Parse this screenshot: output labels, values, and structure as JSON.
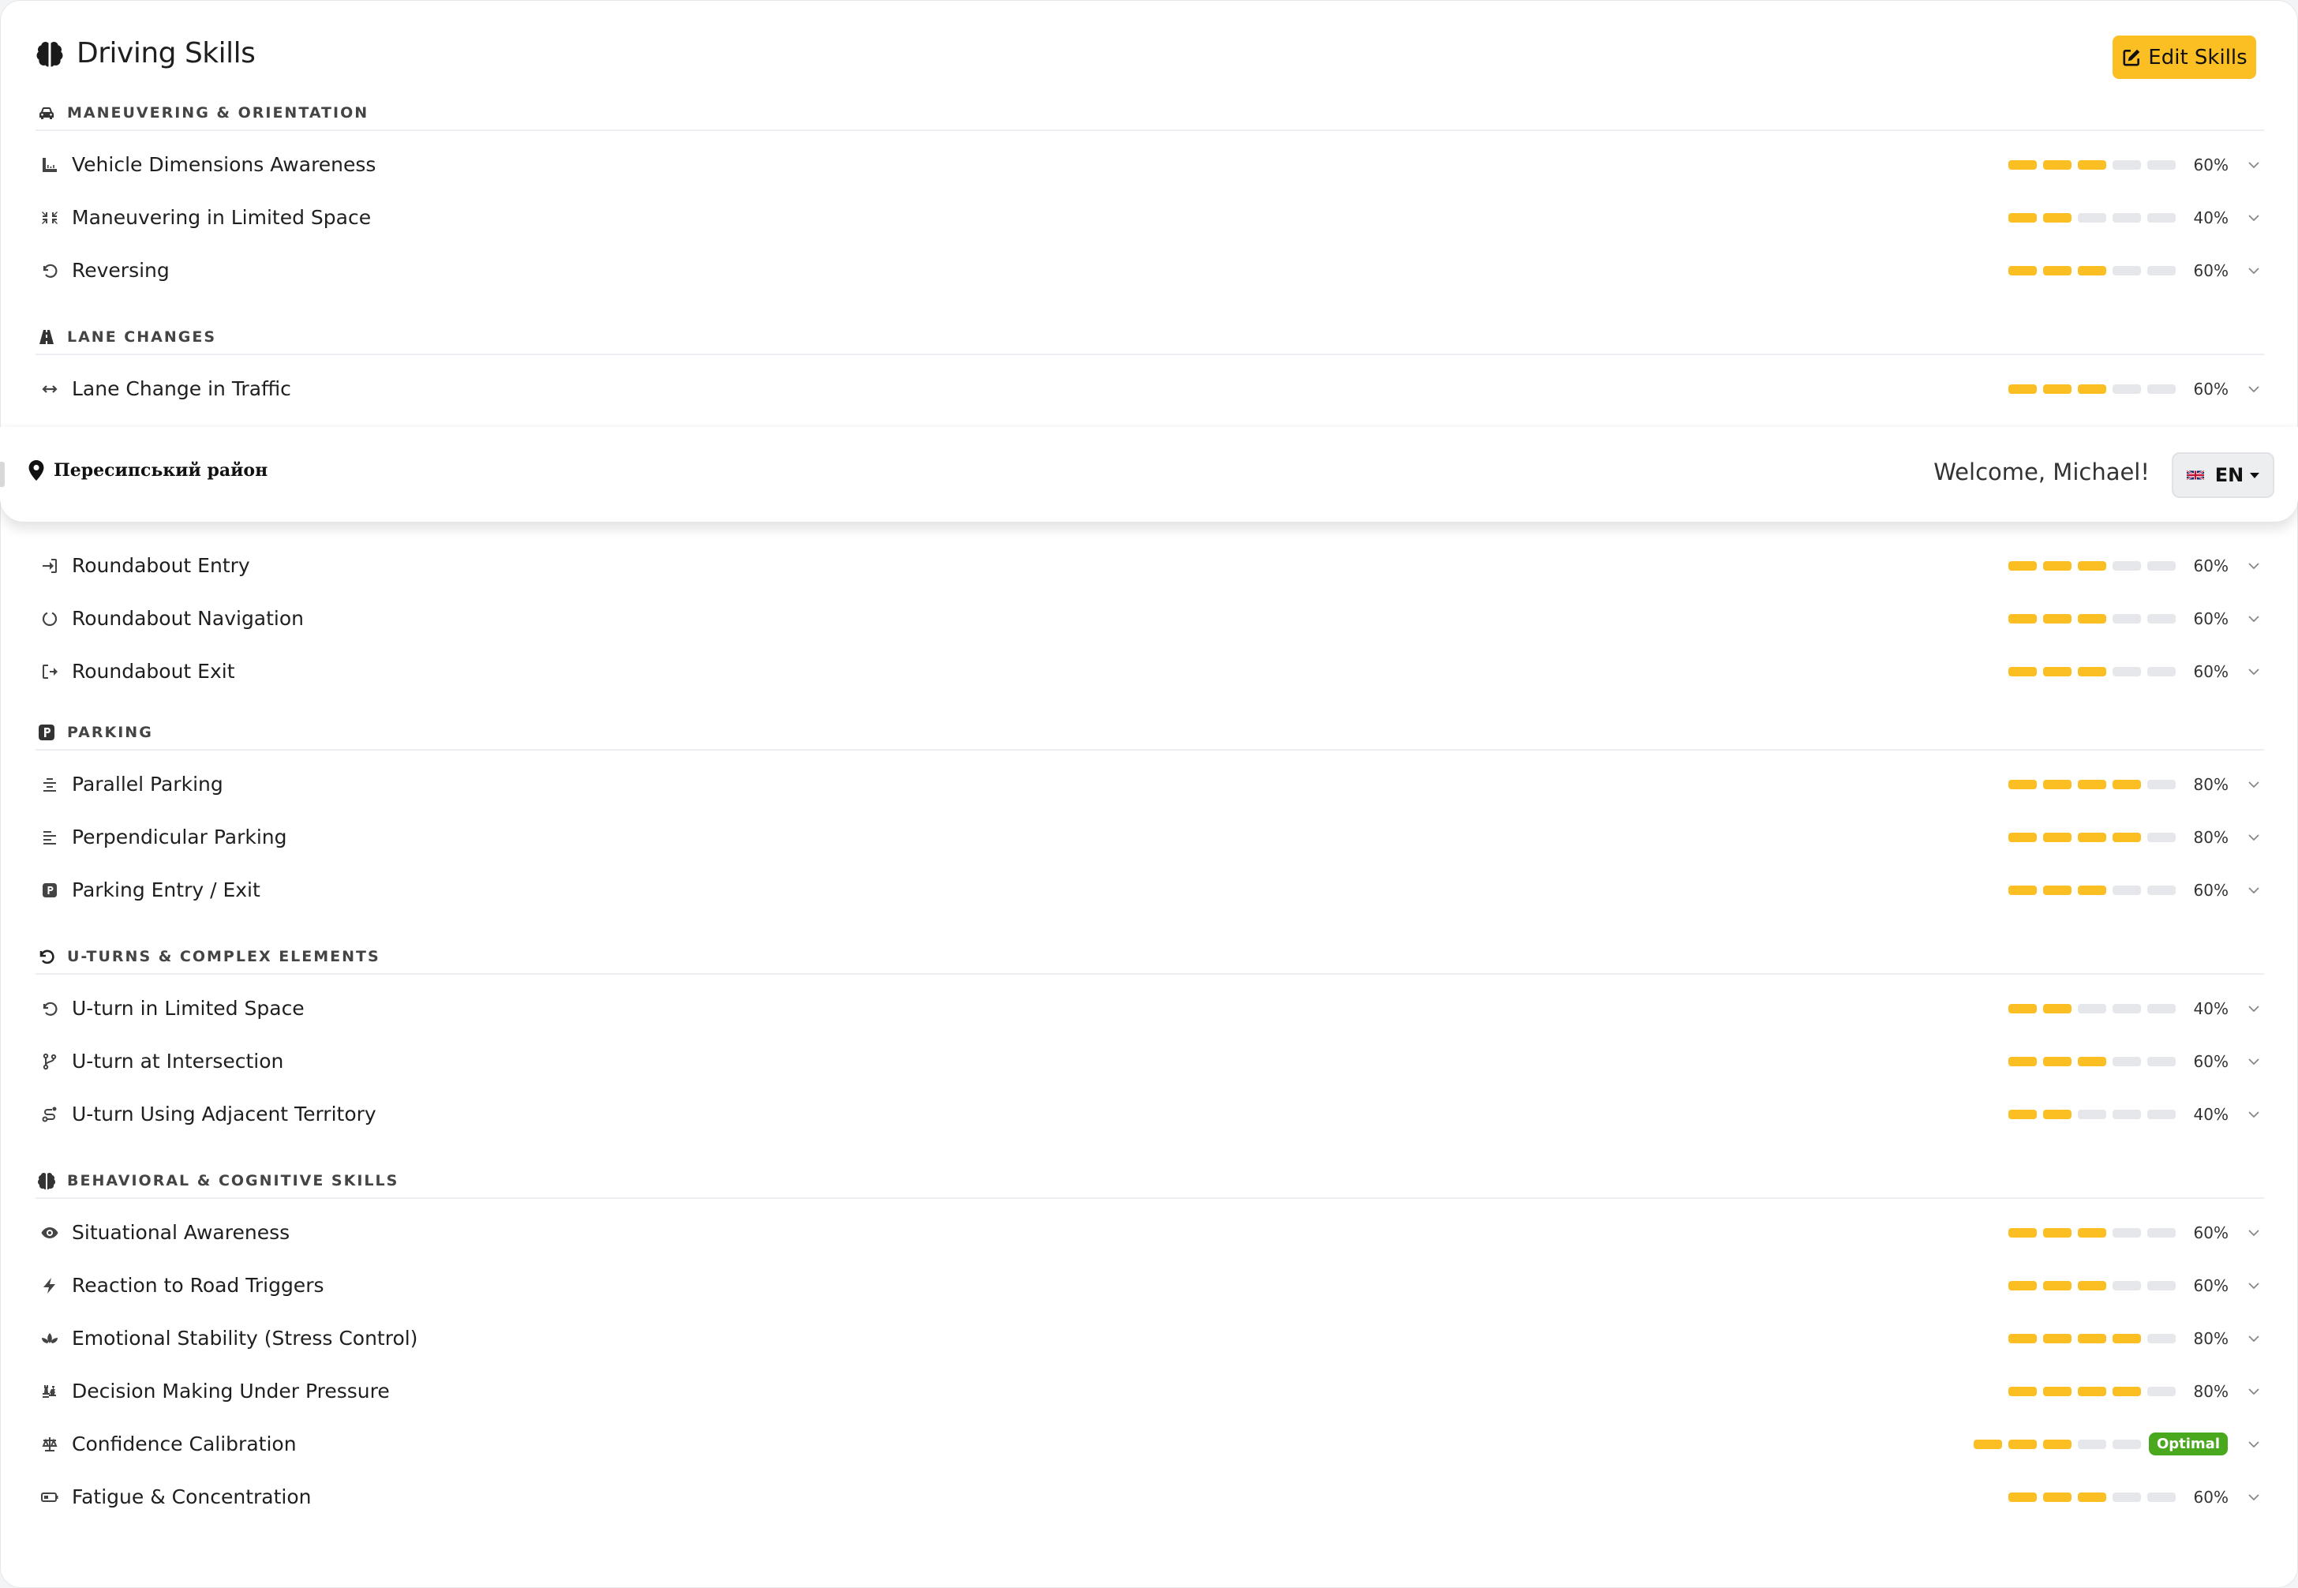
{
  "header": {
    "title": "Driving Skills",
    "icon": "brain-icon",
    "edit_label": "Edit Skills"
  },
  "topbar": {
    "location": "Пересипський район",
    "welcome": "Welcome, Michael!",
    "language": "EN"
  },
  "colors": {
    "accent": "#fbbf24",
    "segment_off": "#e5e7eb",
    "optimal_badge": "#4aa81f"
  },
  "sections": [
    {
      "title": "Maneuvering & Orientation",
      "icon": "car-icon",
      "skills": [
        {
          "label": "Vehicle Dimensions Awareness",
          "icon": "ruler-icon",
          "level": 3,
          "percent": "60%"
        },
        {
          "label": "Maneuvering in Limited Space",
          "icon": "compress-icon",
          "level": 2,
          "percent": "40%"
        },
        {
          "label": "Reversing",
          "icon": "undo-icon",
          "level": 3,
          "percent": "60%"
        }
      ]
    },
    {
      "title": "Lane Changes",
      "icon": "road-icon",
      "skills": [
        {
          "label": "Lane Change in Traffic",
          "icon": "arrows-horizontal-icon",
          "level": 3,
          "percent": "60%"
        }
      ]
    },
    {
      "title": "",
      "icon": "",
      "skills": [
        {
          "label": "Roundabout Entry",
          "icon": "sign-in-icon",
          "level": 3,
          "percent": "60%"
        },
        {
          "label": "Roundabout Navigation",
          "icon": "circle-notch-icon",
          "level": 3,
          "percent": "60%"
        },
        {
          "label": "Roundabout Exit",
          "icon": "sign-out-icon",
          "level": 3,
          "percent": "60%"
        }
      ]
    },
    {
      "title": "Parking",
      "icon": "parking-icon",
      "skills": [
        {
          "label": "Parallel Parking",
          "icon": "align-center-icon",
          "level": 4,
          "percent": "80%"
        },
        {
          "label": "Perpendicular Parking",
          "icon": "align-left-icon",
          "level": 4,
          "percent": "80%"
        },
        {
          "label": "Parking Entry / Exit",
          "icon": "parking-icon",
          "level": 3,
          "percent": "60%"
        }
      ]
    },
    {
      "title": "U-turns & Complex Elements",
      "icon": "undo-icon",
      "skills": [
        {
          "label": "U-turn in Limited Space",
          "icon": "undo-icon",
          "level": 2,
          "percent": "40%"
        },
        {
          "label": "U-turn at Intersection",
          "icon": "code-branch-icon",
          "level": 3,
          "percent": "60%"
        },
        {
          "label": "U-turn Using Adjacent Territory",
          "icon": "route-icon",
          "level": 2,
          "percent": "40%"
        }
      ]
    },
    {
      "title": "Behavioral & Cognitive Skills",
      "icon": "brain-icon",
      "skills": [
        {
          "label": "Situational Awareness",
          "icon": "eye-icon",
          "level": 3,
          "percent": "60%"
        },
        {
          "label": "Reaction to Road Triggers",
          "icon": "bolt-icon",
          "level": 3,
          "percent": "60%"
        },
        {
          "label": "Emotional Stability (Stress Control)",
          "icon": "spa-icon",
          "level": 4,
          "percent": "80%"
        },
        {
          "label": "Decision Making Under Pressure",
          "icon": "chess-icon",
          "level": 4,
          "percent": "80%"
        },
        {
          "label": "Confidence Calibration",
          "icon": "balance-scale-icon",
          "level": 3,
          "percent": "",
          "badge": "Optimal"
        },
        {
          "label": "Fatigue & Concentration",
          "icon": "battery-quarter-icon",
          "level": 3,
          "percent": "60%"
        }
      ]
    }
  ]
}
